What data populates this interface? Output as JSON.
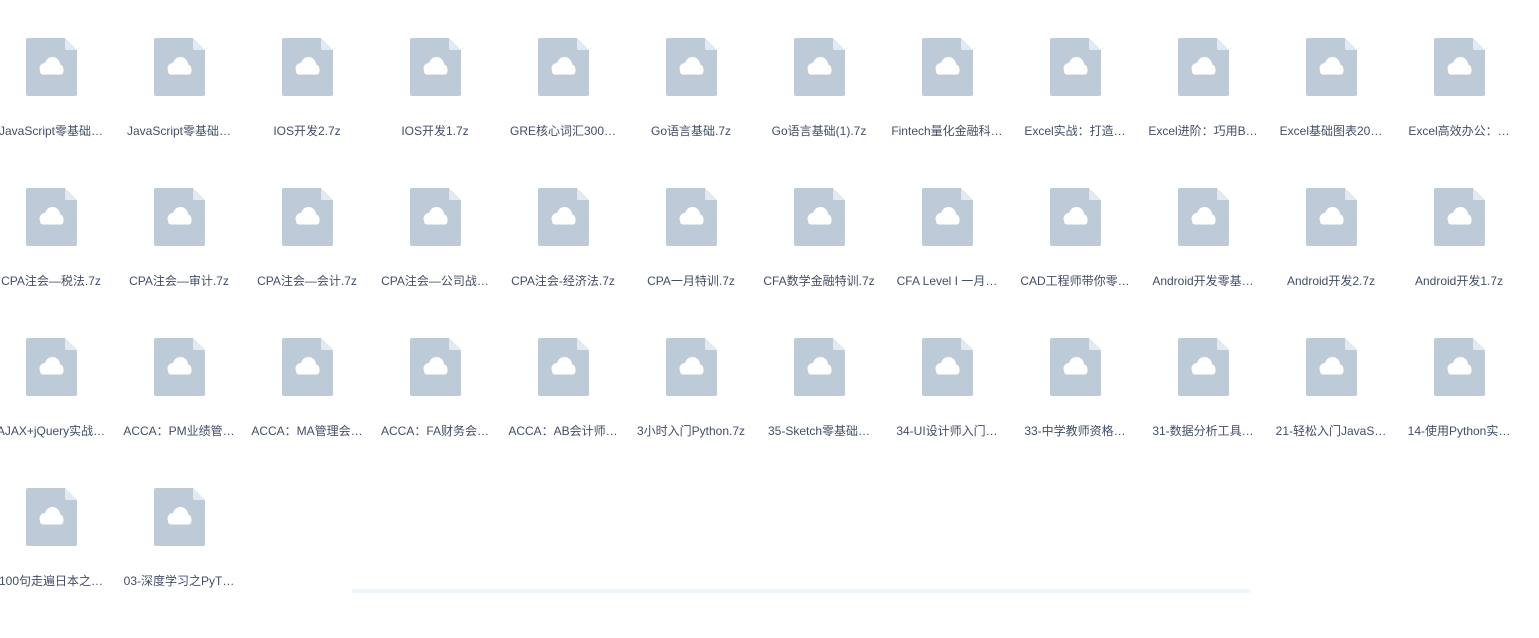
{
  "colors": {
    "icon_fill": "#bccbd7",
    "icon_fold": "#e3ebf1",
    "text": "#424e67"
  },
  "icon": "cloud-file-icon",
  "files": [
    "JavaScript零基础…",
    "JavaScript零基础…",
    "IOS开发2.7z",
    "IOS开发1.7z",
    "GRE核心词汇300…",
    "Go语言基础.7z",
    "Go语言基础(1).7z",
    "Fintech量化金融科…",
    "Excel实战：打造…",
    "Excel进阶：巧用B…",
    "Excel基础图表20…",
    "Excel高效办公：…",
    "CPA注会—税法.7z",
    "CPA注会—审计.7z",
    "CPA注会—会计.7z",
    "CPA注会—公司战…",
    "CPA注会-经济法.7z",
    "CPA一月特训.7z",
    "CFA数学金融特训.7z",
    "CFA Level I 一月…",
    "CAD工程师带你零…",
    "Android开发零基…",
    "Android开发2.7z",
    "Android开发1.7z",
    "AJAX+jQuery实战…",
    "ACCA：PM业绩管…",
    "ACCA：MA管理会…",
    "ACCA：FA财务会…",
    "ACCA：AB会计师…",
    "3小时入门Python.7z",
    "35-Sketch零基础…",
    "34-UI设计师入门…",
    "33-中学教师资格…",
    "31-数据分析工具…",
    "21-轻松入门JavaS…",
    "14-使用Python实…",
    "100句走遍日本之…",
    "03-深度学习之PyT…"
  ]
}
